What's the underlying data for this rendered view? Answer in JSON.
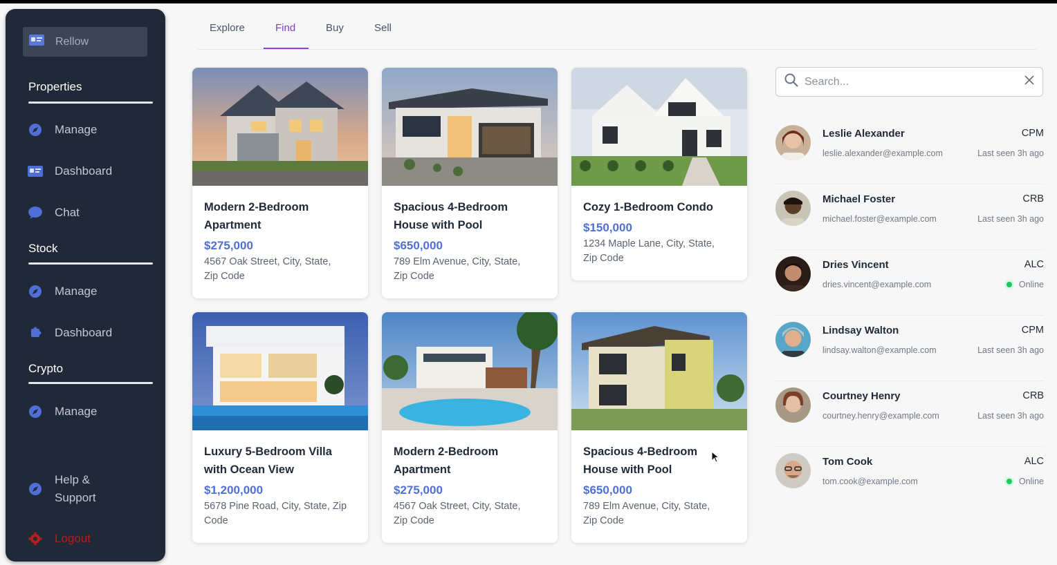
{
  "sidebar": {
    "brand": "Rellow",
    "sections": [
      {
        "title": "Properties",
        "items": [
          "Manage",
          "Dashboard",
          "Chat"
        ]
      },
      {
        "title": "Stock",
        "items": [
          "Manage",
          "Dashboard"
        ]
      },
      {
        "title": "Crypto",
        "items": [
          "Manage"
        ]
      }
    ],
    "help_line1": "Help &",
    "help_line2": "Support",
    "logout": "Logout"
  },
  "tabs": [
    "Explore",
    "Find",
    "Buy",
    "Sell"
  ],
  "active_tab": "Find",
  "listings": [
    {
      "title_line1": "Modern 2-Bedroom",
      "title_line2": "Apartment",
      "price": "$275,000",
      "addr_line1": "4567 Oak Street, City, State,",
      "addr_line2": "Zip Code"
    },
    {
      "title_line1": "Spacious 4-Bedroom",
      "title_line2": "House with Pool",
      "price": "$650,000",
      "addr_line1": "789 Elm Avenue, City, State,",
      "addr_line2": "Zip Code"
    },
    {
      "title_line1": "Cozy 1-Bedroom Condo",
      "title_line2": "",
      "price": "$150,000",
      "addr_line1": "1234 Maple Lane, City, State,",
      "addr_line2": "Zip Code"
    },
    {
      "title_line1": "Luxury 5-Bedroom Villa",
      "title_line2": "with Ocean View",
      "price": "$1,200,000",
      "addr_line1": "5678 Pine Road, City, State, Zip",
      "addr_line2": "Code"
    },
    {
      "title_line1": "Modern 2-Bedroom",
      "title_line2": "Apartment",
      "price": "$275,000",
      "addr_line1": "4567 Oak Street, City, State,",
      "addr_line2": "Zip Code"
    },
    {
      "title_line1": "Spacious 4-Bedroom",
      "title_line2": "House with Pool",
      "price": "$650,000",
      "addr_line1": "789 Elm Avenue, City, State,",
      "addr_line2": "Zip Code"
    }
  ],
  "search": {
    "placeholder": "Search..."
  },
  "people": [
    {
      "name": "Leslie Alexander",
      "email": "leslie.alexander@example.com",
      "role": "CPM",
      "status": "Last seen 3h ago",
      "online": false
    },
    {
      "name": "Michael Foster",
      "email": "michael.foster@example.com",
      "role": "CRB",
      "status": "Last seen 3h ago",
      "online": false
    },
    {
      "name": "Dries Vincent",
      "email": "dries.vincent@example.com",
      "role": "ALC",
      "status": "Online",
      "online": true
    },
    {
      "name": "Lindsay Walton",
      "email": "lindsay.walton@example.com",
      "role": "CPM",
      "status": "Last seen 3h ago",
      "online": false
    },
    {
      "name": "Courtney Henry",
      "email": "courtney.henry@example.com",
      "role": "CRB",
      "status": "Last seen 3h ago",
      "online": false
    },
    {
      "name": "Tom Cook",
      "email": "tom.cook@example.com",
      "role": "ALC",
      "status": "Online",
      "online": true
    }
  ],
  "colors": {
    "sidebar_bg": "#1f2937",
    "accent_purple": "#7e3fc4",
    "price_blue": "#4f6fd7",
    "online_green": "#22c55e",
    "logout_red": "#b91c1c"
  }
}
